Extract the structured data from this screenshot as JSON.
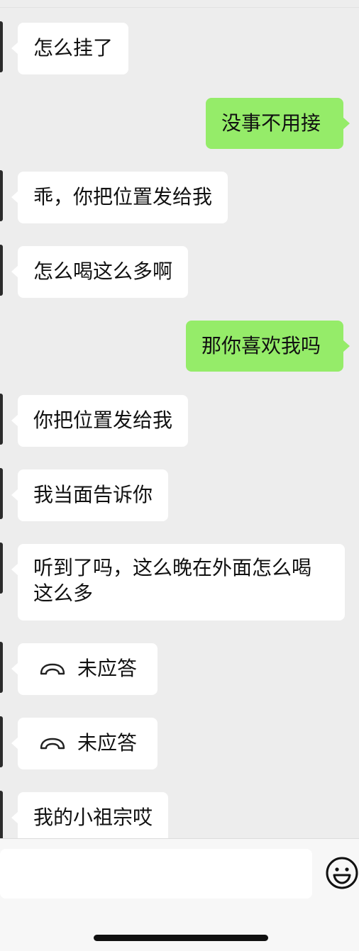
{
  "messages": [
    {
      "side": "in",
      "text": "怎么挂了"
    },
    {
      "side": "out",
      "text": "没事不用接"
    },
    {
      "side": "in",
      "text": "乖，你把位置发给我"
    },
    {
      "side": "in",
      "text": "怎么喝这么多啊"
    },
    {
      "side": "out",
      "text": "那你喜欢我吗"
    },
    {
      "side": "in",
      "text": "你把位置发给我"
    },
    {
      "side": "in",
      "text": "我当面告诉你"
    },
    {
      "side": "in",
      "text": "听到了吗，这么晚在外面怎么喝这么多"
    },
    {
      "side": "in",
      "type": "call",
      "icon": "phone-hangup-icon",
      "text": "未应答"
    },
    {
      "side": "in",
      "type": "call",
      "icon": "phone-hangup-icon",
      "text": "未应答"
    },
    {
      "side": "in",
      "text": "我的小祖宗哎"
    }
  ],
  "input_bar": {
    "value": "",
    "emoji_icon": "smiley-face-icon"
  },
  "colors": {
    "background": "#ededed",
    "incoming_bubble": "#ffffff",
    "outgoing_bubble": "#95ec69",
    "text": "#111111"
  }
}
